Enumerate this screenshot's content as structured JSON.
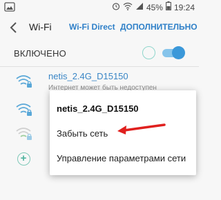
{
  "status_bar": {
    "battery_percent": "45%",
    "time": "19:24",
    "icons": [
      "gallery-icon",
      "alarm-icon",
      "wifi-icon",
      "signal-icon",
      "battery-icon"
    ]
  },
  "header": {
    "back_icon": "back-arrow-icon",
    "title": "Wi-Fi",
    "wifi_direct": "Wi-Fi Direct",
    "more": "ДОПОЛНИТЕЛЬНО"
  },
  "switch_row": {
    "label": "ВКЛЮЧЕНО",
    "enabled": true
  },
  "networks": [
    {
      "name": "netis_2.4G_D15150",
      "status": "Интернет может быть недоступен",
      "secured": true,
      "signal": "full"
    },
    {
      "secured": true,
      "signal": "full"
    },
    {
      "secured": true,
      "signal": "weak"
    }
  ],
  "add_network_icon": "plus-circle-icon",
  "context_menu": {
    "title": "netis_2.4G_D15150",
    "items": [
      "Забыть сеть",
      "Управление параметрами сети"
    ]
  },
  "colors": {
    "accent": "#2f80c8",
    "toggle_on": "#3b98d9",
    "wifi_icon": "#5aa8d8",
    "arrow": "#e0201e"
  }
}
